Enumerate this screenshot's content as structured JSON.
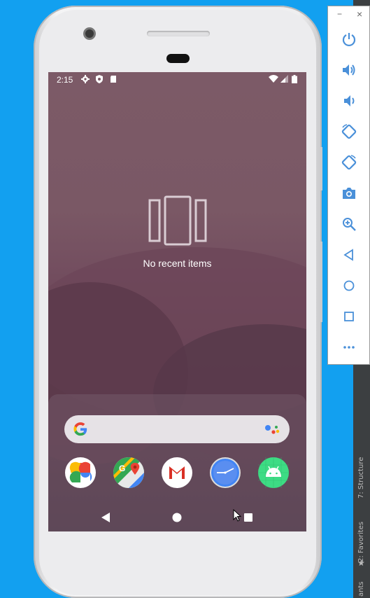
{
  "status_bar": {
    "time": "2:15"
  },
  "recents": {
    "empty_text": "No recent items"
  },
  "ide": {
    "tab_structure": "7: Structure",
    "tab_favorites": "2: Favorites",
    "tab_bottom": "ants"
  },
  "toolbar": {
    "minimize": "−",
    "close": "×",
    "buttons": [
      "power",
      "volume-up",
      "volume-down",
      "rotate-left",
      "rotate-right",
      "screenshot",
      "zoom",
      "back",
      "home",
      "overview",
      "more"
    ]
  },
  "dock_apps": [
    "Photos",
    "Maps",
    "Gmail",
    "Clock",
    "Android"
  ],
  "colors": {
    "accent": "#4285F4",
    "toolbar_icon": "#4a90d9",
    "desktop": "#12a0f0"
  }
}
